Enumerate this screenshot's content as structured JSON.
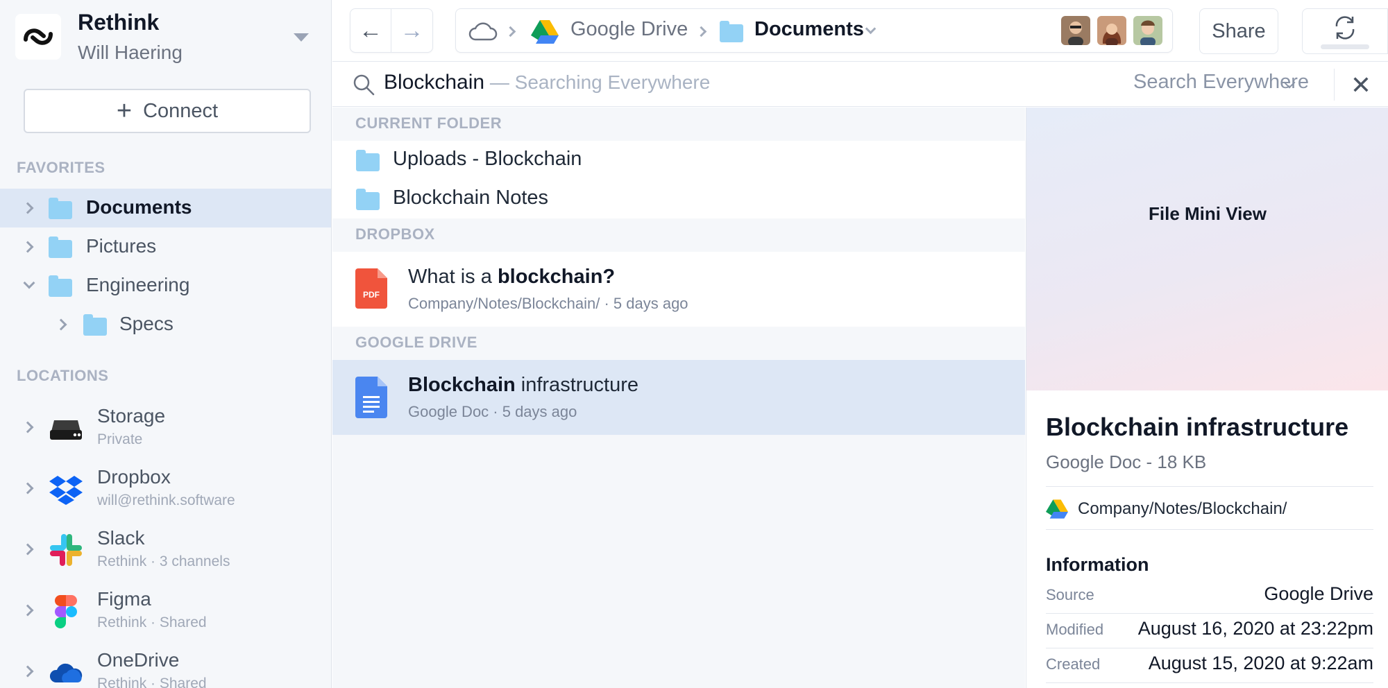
{
  "sidebar": {
    "brand": {
      "name": "Rethink",
      "user": "Will Haering"
    },
    "connect_label": "Connect",
    "favorites_heading": "FAVORITES",
    "favorites": [
      {
        "label": "Documents",
        "expanded": false,
        "active": true
      },
      {
        "label": "Pictures",
        "expanded": false
      },
      {
        "label": "Engineering",
        "expanded": true
      },
      {
        "label": "Specs",
        "expanded": false
      }
    ],
    "locations_heading": "LOCATIONS",
    "locations": [
      {
        "title": "Storage",
        "subtitle": "Private",
        "icon": "storage-drive-icon"
      },
      {
        "title": "Dropbox",
        "subtitle": "will@rethink.software",
        "icon": "dropbox-icon"
      },
      {
        "title": "Slack",
        "subtitle": "Rethink · 3 channels",
        "icon": "slack-icon"
      },
      {
        "title": "Figma",
        "subtitle": "Rethink · Shared",
        "icon": "figma-icon"
      },
      {
        "title": "OneDrive",
        "subtitle": "Rethink · Shared",
        "icon": "onedrive-icon"
      }
    ]
  },
  "topbar": {
    "breadcrumb": [
      "Google Drive",
      "Documents"
    ],
    "share_label": "Share"
  },
  "search": {
    "query": "Blockchain",
    "hint": " — Searching Everywhere",
    "scope": "Search Everywhere"
  },
  "results": {
    "groups": [
      {
        "heading": "CURRENT FOLDER",
        "items": [
          {
            "label": "Uploads - Blockchain"
          },
          {
            "label": "Blockchain Notes"
          }
        ]
      },
      {
        "heading": "DROPBOX",
        "items": [
          {
            "prefix": "What is a ",
            "bold": "blockchain?",
            "meta": "Company/Notes/Blockchain/ · 5 days ago",
            "file_type": "PDF"
          }
        ]
      },
      {
        "heading": "GOOGLE DRIVE",
        "items": [
          {
            "bold": "Blockchain",
            "suffix": " infrastructure",
            "meta": "Google Doc · 5 days ago",
            "selected": true
          }
        ]
      }
    ]
  },
  "detail": {
    "mini_view_label": "File Mini View",
    "title": "Blockchain infrastructure",
    "subtitle": "Google Doc - 18 KB",
    "path": "Company/Notes/Blockchain/",
    "info_heading": "Information",
    "info": [
      {
        "key": "Source",
        "value": "Google Drive"
      },
      {
        "key": "Modified",
        "value": "August 16, 2020 at 23:22pm"
      },
      {
        "key": "Created",
        "value": "August 15, 2020 at 9:22am"
      }
    ]
  },
  "colors": {
    "accent_folder": "#93d2f5",
    "selected_row": "#dde7f5",
    "pdf_red": "#f0543c",
    "gdoc_blue": "#4a86f0"
  }
}
